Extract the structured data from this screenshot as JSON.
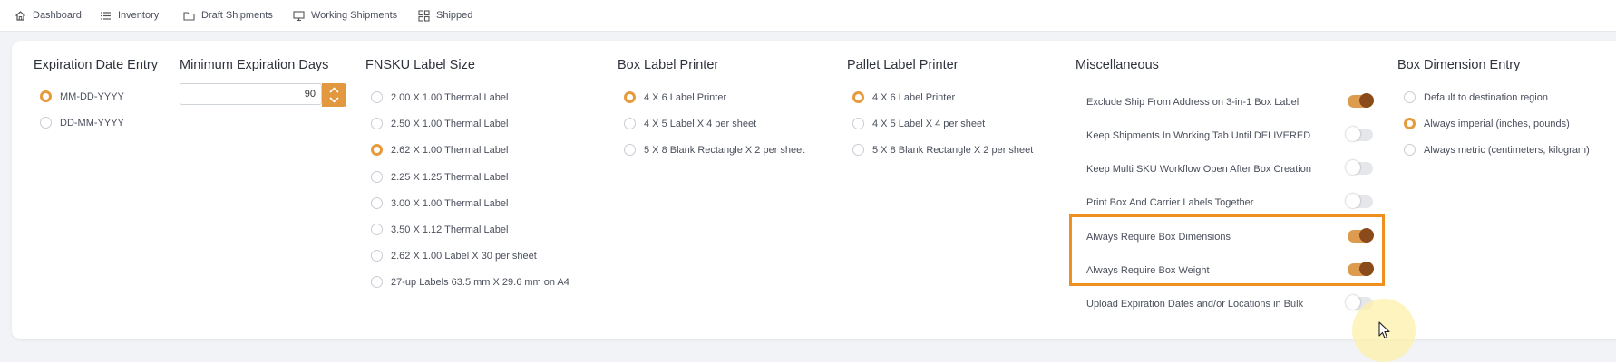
{
  "nav": {
    "items": [
      {
        "label": "Dashboard",
        "icon": "home-icon"
      },
      {
        "label": "Inventory",
        "icon": "list-icon"
      },
      {
        "label": "Draft Shipments",
        "icon": "folder-icon"
      },
      {
        "label": "Working Shipments",
        "icon": "monitor-icon"
      },
      {
        "label": "Shipped",
        "icon": "grid-icon"
      }
    ]
  },
  "expiration_date_entry": {
    "title": "Expiration Date Entry",
    "options": [
      {
        "label": "MM-DD-YYYY",
        "selected": true
      },
      {
        "label": "DD-MM-YYYY",
        "selected": false
      }
    ]
  },
  "minimum_expiration_days": {
    "title": "Minimum Expiration Days",
    "value": "90"
  },
  "fnsku_label_size": {
    "title": "FNSKU Label Size",
    "options": [
      {
        "label": "2.00 X 1.00 Thermal Label",
        "selected": false
      },
      {
        "label": "2.50 X 1.00 Thermal Label",
        "selected": false
      },
      {
        "label": "2.62 X 1.00 Thermal Label",
        "selected": true
      },
      {
        "label": "2.25 X 1.25 Thermal Label",
        "selected": false
      },
      {
        "label": "3.00 X 1.00 Thermal Label",
        "selected": false
      },
      {
        "label": "3.50 X 1.12 Thermal Label",
        "selected": false
      },
      {
        "label": "2.62 X 1.00 Label X 30 per sheet",
        "selected": false
      },
      {
        "label": "27-up Labels 63.5 mm X 29.6 mm on A4",
        "selected": false
      }
    ]
  },
  "box_label_printer": {
    "title": "Box Label Printer",
    "options": [
      {
        "label": "4 X 6 Label Printer",
        "selected": true
      },
      {
        "label": "4 X 5 Label X 4 per sheet",
        "selected": false
      },
      {
        "label": "5 X 8 Blank Rectangle X 2 per sheet",
        "selected": false
      }
    ]
  },
  "pallet_label_printer": {
    "title": "Pallet Label Printer",
    "options": [
      {
        "label": "4 X 6 Label Printer",
        "selected": true
      },
      {
        "label": "4 X 5 Label X 4 per sheet",
        "selected": false
      },
      {
        "label": "5 X 8 Blank Rectangle X 2 per sheet",
        "selected": false
      }
    ]
  },
  "miscellaneous": {
    "title": "Miscellaneous",
    "items": [
      {
        "label": "Exclude Ship From Address on 3-in-1 Box Label",
        "on": true
      },
      {
        "label": "Keep Shipments In Working Tab Until DELIVERED",
        "on": false
      },
      {
        "label": "Keep Multi SKU Workflow Open After Box Creation",
        "on": false
      },
      {
        "label": "Print Box And Carrier Labels Together",
        "on": false
      },
      {
        "label": "Always Require Box Dimensions",
        "on": true
      },
      {
        "label": "Always Require Box Weight",
        "on": true
      },
      {
        "label": "Upload Expiration Dates and/or Locations in Bulk",
        "on": false
      }
    ]
  },
  "box_dimension_entry": {
    "title": "Box Dimension Entry",
    "options": [
      {
        "label": "Default to destination region",
        "selected": false
      },
      {
        "label": "Always imperial (inches, pounds)",
        "selected": true
      },
      {
        "label": "Always metric (centimeters, kilogram)",
        "selected": false
      }
    ]
  },
  "colors": {
    "accent": "#e79a3c",
    "toggle_on_track": "#dd9b4f",
    "toggle_on_knob": "#8a4a19",
    "highlight": "#ee8f1f"
  }
}
